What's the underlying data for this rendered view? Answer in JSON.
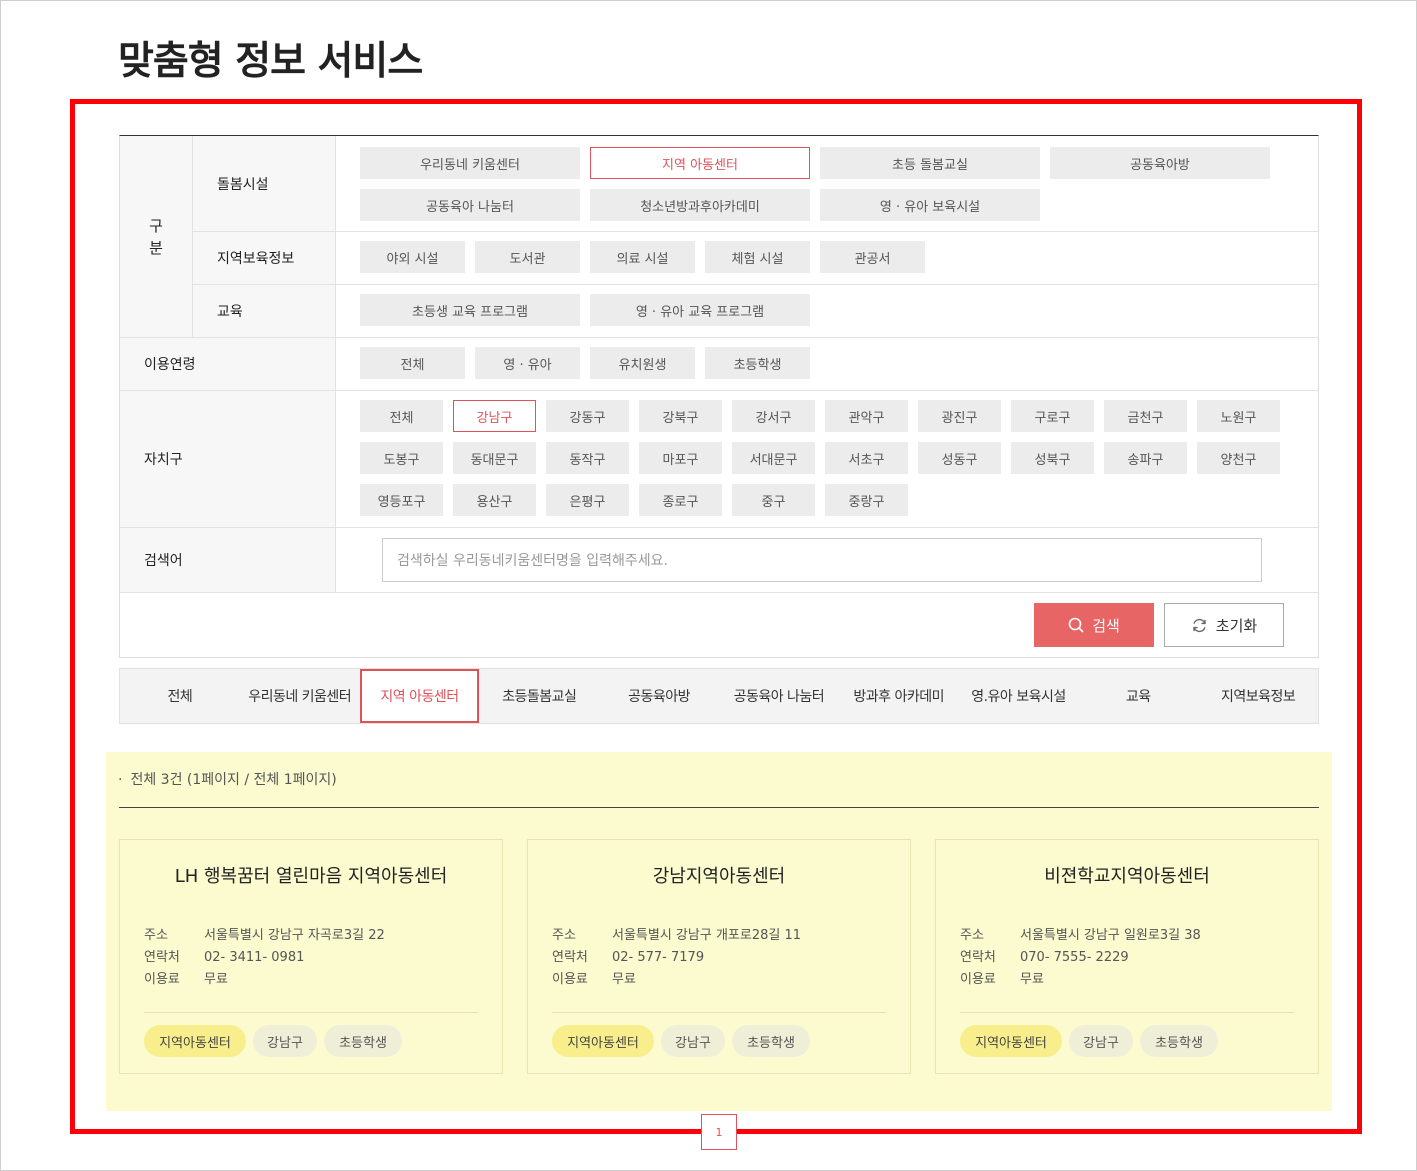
{
  "page_title": "맞춤형 정보 서비스",
  "filter": {
    "category_label": "구\n분",
    "care_label": "돌봄시설",
    "care_items": [
      "우리동네 키움센터",
      "지역 아동센터",
      "초등 돌봄교실",
      "공동육아방",
      "공동육아 나눔터",
      "청소년방과후아카데미",
      "영 · 유아 보육시설"
    ],
    "care_selected": "지역 아동센터",
    "local_label": "지역보육정보",
    "local_items": [
      "야외 시설",
      "도서관",
      "의료 시설",
      "체험 시설",
      "관공서"
    ],
    "edu_label": "교육",
    "edu_items": [
      "초등생 교육 프로그램",
      "영 · 유아 교육 프로그램"
    ],
    "age_label": "이용연령",
    "age_items": [
      "전체",
      "영 · 유아",
      "유치원생",
      "초등학생"
    ],
    "district_label": "자치구",
    "district_items": [
      "전체",
      "강남구",
      "강동구",
      "강북구",
      "강서구",
      "관악구",
      "광진구",
      "구로구",
      "금천구",
      "노원구",
      "도봉구",
      "동대문구",
      "동작구",
      "마포구",
      "서대문구",
      "서초구",
      "성동구",
      "성북구",
      "송파구",
      "양천구",
      "영등포구",
      "용산구",
      "은평구",
      "종로구",
      "중구",
      "중랑구"
    ],
    "district_selected": "강남구",
    "keyword_label": "검색어",
    "keyword_placeholder": "검색하실 우리동네키움센터명을 입력해주세요.",
    "search_label": "검색",
    "reset_label": "초기화"
  },
  "tabs": [
    "전체",
    "우리동네 키움센터",
    "지역 아동센터",
    "초등돌봄교실",
    "공동육아방",
    "공동육아 나눔터",
    "방과후 아카데미",
    "영.유아 보육시설",
    "교육",
    "지역보육정보"
  ],
  "tab_selected": "지역 아동센터",
  "results": {
    "count_text": "전체 3건 (1페이지 / 전체 1페이지)",
    "field_labels": {
      "address": "주소",
      "phone": "연락처",
      "fee": "이용료"
    },
    "cards": [
      {
        "name": "LH 행복꿈터 열린마음 지역아동센터",
        "address": "서울특별시 강남구 자곡로3길 22",
        "phone": "02- 3411- 0981",
        "fee": "무료",
        "tags": [
          "지역아동센터",
          "강남구",
          "초등학생"
        ]
      },
      {
        "name": "강남지역아동센터",
        "address": "서울특별시 강남구 개포로28길 11",
        "phone": "02- 577- 7179",
        "fee": "무료",
        "tags": [
          "지역아동센터",
          "강남구",
          "초등학생"
        ]
      },
      {
        "name": "비젼학교지역아동센터",
        "address": "서울특별시 강남구 일원로3길 38",
        "phone": "070- 7555- 2229",
        "fee": "무료",
        "tags": [
          "지역아동센터",
          "강남구",
          "초등학생"
        ]
      }
    ]
  },
  "pager": {
    "current": "1"
  },
  "colors": {
    "accent": "#e0525a",
    "search_button": "#e86566",
    "result_bg": "#fbfbcf",
    "highlight": "#ff0008"
  }
}
